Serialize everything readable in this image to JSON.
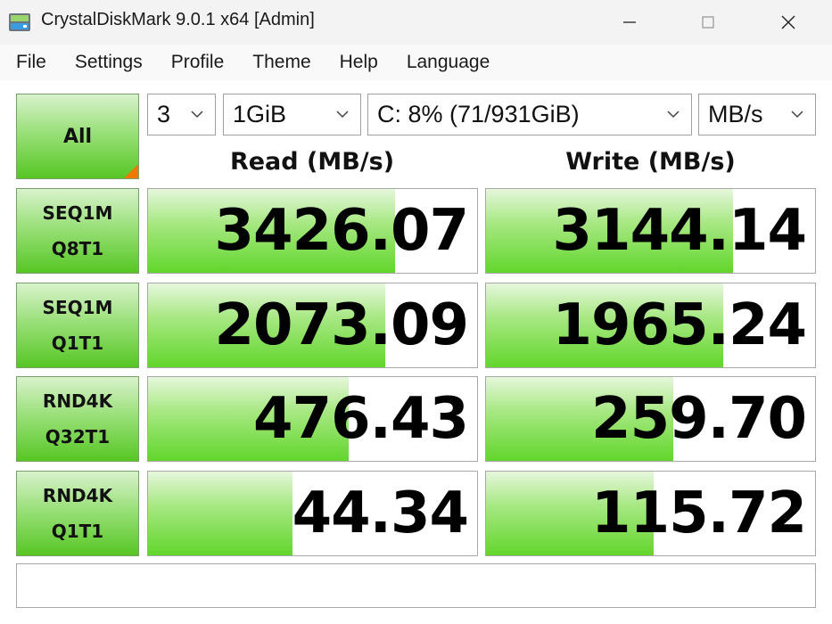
{
  "window": {
    "title": "CrystalDiskMark 9.0.1 x64 [Admin]",
    "icon": "crystaldiskmark-app-icon"
  },
  "menu": [
    "File",
    "Settings",
    "Profile",
    "Theme",
    "Help",
    "Language"
  ],
  "controls": {
    "all_label": "All",
    "count": "3",
    "size": "1GiB",
    "drive": "C: 8% (71/931GiB)",
    "unit": "MB/s"
  },
  "headers": {
    "read": "Read (MB/s)",
    "write": "Write (MB/s)"
  },
  "tests": [
    {
      "line1": "SEQ1M",
      "line2": "Q8T1",
      "read": "3426.07",
      "write": "3144.14",
      "read_fill": 0.75,
      "write_fill": 0.75
    },
    {
      "line1": "SEQ1M",
      "line2": "Q1T1",
      "read": "2073.09",
      "write": "1965.24",
      "read_fill": 0.72,
      "write_fill": 0.72
    },
    {
      "line1": "RND4K",
      "line2": "Q32T1",
      "read": "476.43",
      "write": "259.70",
      "read_fill": 0.61,
      "write_fill": 0.57
    },
    {
      "line1": "RND4K",
      "line2": "Q1T1",
      "read": "44.34",
      "write": "115.72",
      "read_fill": 0.44,
      "write_fill": 0.51
    }
  ],
  "comment": "",
  "colors": {
    "bar_green": "#62d62c",
    "accent_orange": "#f07800"
  }
}
